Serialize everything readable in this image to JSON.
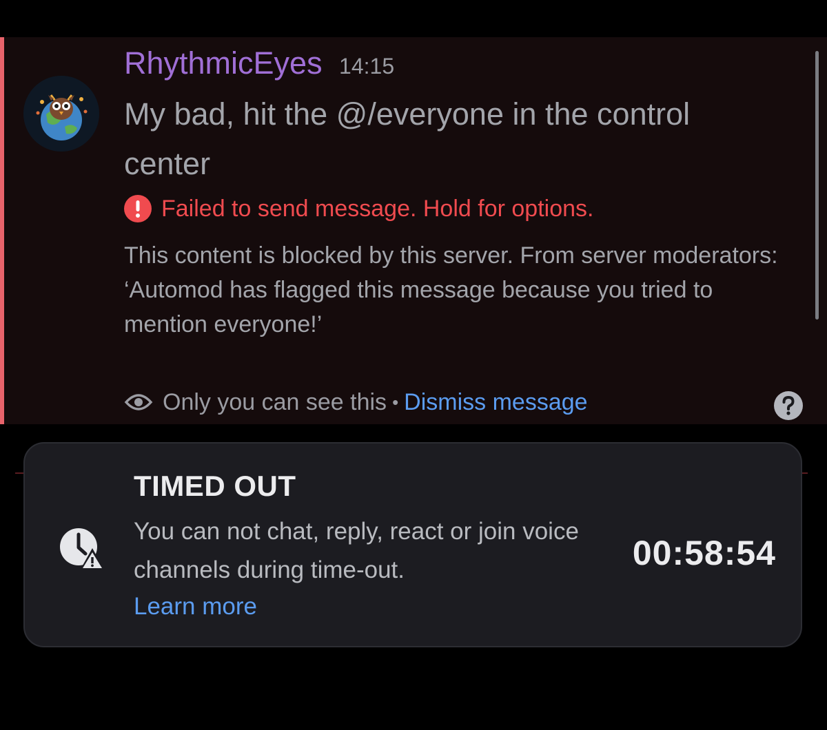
{
  "message": {
    "author": "RhythmicEyes",
    "author_color": "#a06fd6",
    "timestamp": "14:15",
    "text": "My bad, hit the @/everyone in the control center",
    "avatar_icon": "earth-owl-avatar",
    "error": {
      "icon": "exclamation-circle-icon",
      "text": "Failed to send message. Hold for options.",
      "color": "#f04b4f"
    },
    "block_notice": {
      "line1": "This content is blocked by this server. From server moderators:",
      "line2": "‘Automod has flagged this message because you tried to mention everyone!’"
    },
    "ephemeral": {
      "icon": "eye-icon",
      "text": "Only you can see this",
      "separator": "•",
      "dismiss_label": "Dismiss message"
    },
    "help_icon": "question-circle-icon",
    "accent_color": "#e8636b",
    "background_color": "#150b0c"
  },
  "timeout": {
    "icon": "clock-warning-icon",
    "title": "TIMED OUT",
    "description": "You can not chat, reply, react or join voice channels during time-out.",
    "learn_more_label": "Learn more",
    "countdown": "00:58:54",
    "link_color": "#5b9cf0"
  }
}
